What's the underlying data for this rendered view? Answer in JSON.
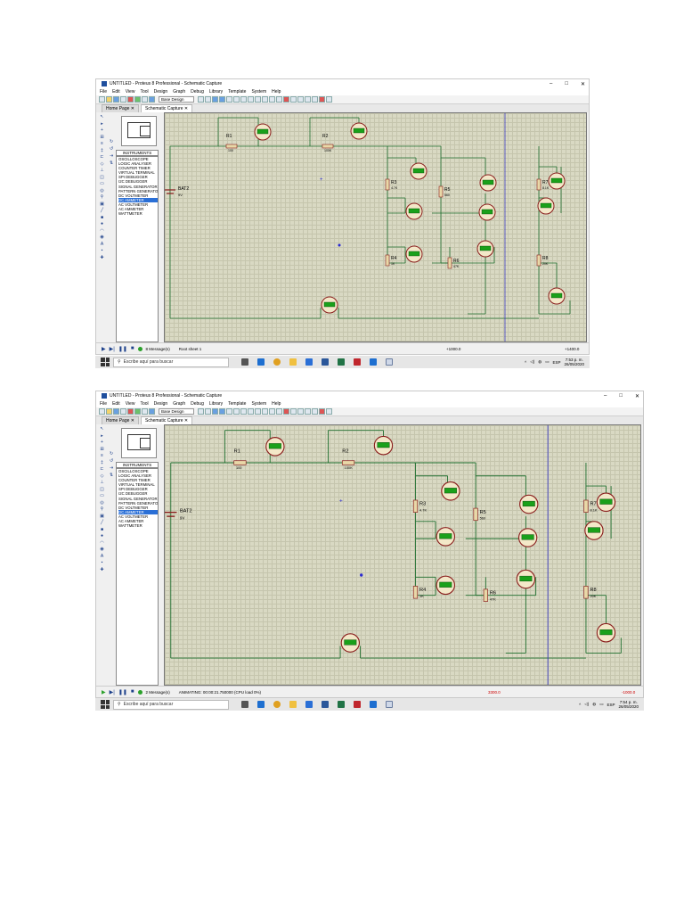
{
  "screens": [
    {
      "title": "UNTITLED - Proteus 8 Professional - Schematic Capture",
      "menu": [
        "File",
        "Edit",
        "View",
        "Tool",
        "Design",
        "Graph",
        "Debug",
        "Library",
        "Template",
        "System",
        "Help"
      ],
      "design_select": "Base Design",
      "tabs": [
        "Home Page",
        "Schematic Capture"
      ],
      "instruments_header": "INSTRUMENTS",
      "instruments": [
        "OSCILLOSCOPE",
        "LOGIC ANALYSER",
        "COUNTER TIMER",
        "VIRTUAL TERMINAL",
        "SPI DEBUGGER",
        "I2C DEBUGGER",
        "SIGNAL GENERATOR",
        "PATTERN GENERATOR",
        "DC VOLTMETER",
        "DC AMMETER",
        "AC VOLTMETER",
        "AC AMMETER",
        "WATTMETER"
      ],
      "selected_instrument": "DC AMMETER",
      "battery": {
        "name": "BAT2",
        "value": "9V"
      },
      "resistors": [
        {
          "name": "R1",
          "value": "100"
        },
        {
          "name": "R2",
          "value": "100K"
        },
        {
          "name": "R3",
          "value": "4.7K"
        },
        {
          "name": "R5",
          "value": "560"
        },
        {
          "name": "R7",
          "value": "8.1K"
        },
        {
          "name": "R4",
          "value": "1K"
        },
        {
          "name": "R6",
          "value": "47K"
        },
        {
          "name": "R8",
          "value": "20K"
        }
      ],
      "status": {
        "messages": "8 Message(s)",
        "sheet": "Root sheet 1",
        "coord1": "+1000.0",
        "coord2": "+1400.0"
      },
      "taskbar": {
        "search_placeholder": "Escribe aquí para buscar",
        "lang": "ESP",
        "time": "7:53 p. m.",
        "date": "26/05/2020"
      },
      "colors": {
        "canvas": "#d9d9c3",
        "wire": "#1f6f2f",
        "meter_display": "#1aa01a",
        "meter_body": "#8a1e1e"
      }
    },
    {
      "title": "UNTITLED - Proteus 8 Professional - Schematic Capture",
      "menu": [
        "File",
        "Edit",
        "View",
        "Tool",
        "Design",
        "Graph",
        "Debug",
        "Library",
        "Template",
        "System",
        "Help"
      ],
      "design_select": "Base Design",
      "tabs": [
        "Home Page",
        "Schematic Capture"
      ],
      "instruments_header": "INSTRUMENTS",
      "instruments": [
        "OSCILLOSCOPE",
        "LOGIC ANALYSER",
        "COUNTER TIMER",
        "VIRTUAL TERMINAL",
        "SPI DEBUGGER",
        "I2C DEBUGGER",
        "SIGNAL GENERATOR",
        "PATTERN GENERATOR",
        "DC VOLTMETER",
        "DC AMMETER",
        "AC VOLTMETER",
        "AC AMMETER",
        "WATTMETER"
      ],
      "selected_instrument": "DC AMMETER",
      "battery": {
        "name": "BAT2",
        "value": "9V"
      },
      "resistors": [
        {
          "name": "R1",
          "value": "100"
        },
        {
          "name": "R2",
          "value": "100K"
        },
        {
          "name": "R3",
          "value": "4.7K"
        },
        {
          "name": "R5",
          "value": "560"
        },
        {
          "name": "R7",
          "value": "8.1K"
        },
        {
          "name": "R4",
          "value": "1K"
        },
        {
          "name": "R6",
          "value": "47K"
        },
        {
          "name": "R8",
          "value": "20K"
        }
      ],
      "status": {
        "messages": "2 Message(s)",
        "sheet": "ANIMATING: 00:00:21.750000 (CPU load 0%)",
        "coord1": "3300.0",
        "coord2": "-1000.0"
      },
      "taskbar": {
        "search_placeholder": "Escribe aquí para buscar",
        "lang": "ESP",
        "time": "7:54 p. m.",
        "date": "26/05/2020"
      },
      "colors": {
        "canvas": "#d9d9c3",
        "wire": "#1f6f2f",
        "meter_display": "#1aa01a",
        "meter_body": "#8a1e1e"
      }
    }
  ]
}
